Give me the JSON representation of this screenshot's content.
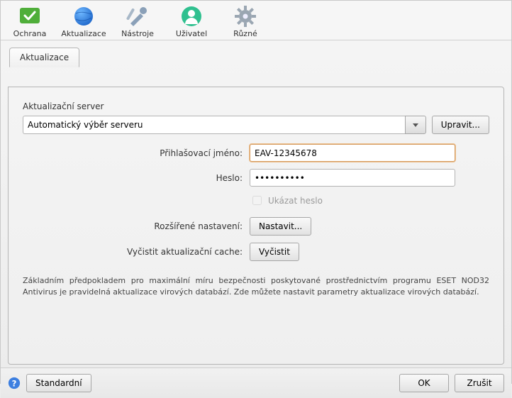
{
  "toolbar": {
    "items": [
      {
        "label": "Ochrana"
      },
      {
        "label": "Aktualizace"
      },
      {
        "label": "Nástroje"
      },
      {
        "label": "Uživatel"
      },
      {
        "label": "Různé"
      }
    ]
  },
  "tab": {
    "label": "Aktualizace"
  },
  "server": {
    "section_label": "Aktualizační server",
    "value": "Automatický výběr serveru",
    "edit_button": "Upravit..."
  },
  "login": {
    "label": "Přihlašovací jméno:",
    "value": "EAV-12345678"
  },
  "password": {
    "label": "Heslo:",
    "value": "••••••••••",
    "show_label": "Ukázat heslo"
  },
  "advanced": {
    "label": "Rozšířené nastavení:",
    "button": "Nastavit..."
  },
  "cache": {
    "label": "Vyčistit aktualizační cache:",
    "button": "Vyčistit"
  },
  "description": "Základním předpokladem pro maximální míru bezpečnosti poskytované prostřednictvím programu ESET NOD32 Antivirus je pravidelná aktualizace virových databází. Zde můžete nastavit parametry aktualizace virových databází.",
  "footer": {
    "default_button": "Standardní",
    "ok_button": "OK",
    "cancel_button": "Zrušit"
  }
}
